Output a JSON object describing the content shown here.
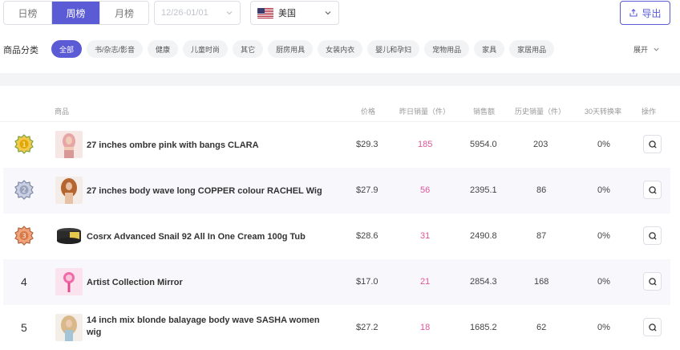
{
  "period_tabs": [
    {
      "label": "日榜",
      "active": false
    },
    {
      "label": "周榜",
      "active": true
    },
    {
      "label": "月榜",
      "active": false
    }
  ],
  "date_range": {
    "placeholder": "12/26-01/01"
  },
  "country": {
    "label": "美国",
    "icon": "us-flag-icon"
  },
  "export_label": "导出",
  "category": {
    "label": "商品分类",
    "chips": [
      "全部",
      "书/杂志/影音",
      "健康",
      "儿童时尚",
      "其它",
      "厨房用具",
      "女装内衣",
      "婴儿和孕妇",
      "宠物用品",
      "家具",
      "家居用品"
    ],
    "active_index": 0,
    "expand_label": "展开"
  },
  "table": {
    "headers": {
      "product": "商品",
      "price": "价格",
      "yesterday_sales": "昨日销量（件）",
      "sales_amount": "销售额",
      "history_sales": "历史销量（件）",
      "conversion": "30天转换率",
      "action": "操作"
    },
    "rows": [
      {
        "rank": "1",
        "medal": "gold-medal-icon",
        "name": "27 inches ombre pink with bangs CLARA",
        "price": "$29.3",
        "yesterday": "185",
        "amount": "5954.0",
        "history": "203",
        "conversion": "0%"
      },
      {
        "rank": "2",
        "medal": "silver-medal-icon",
        "name": "27 inches body wave long COPPER colour RACHEL Wig",
        "price": "$27.9",
        "yesterday": "56",
        "amount": "2395.1",
        "history": "86",
        "conversion": "0%"
      },
      {
        "rank": "3",
        "medal": "bronze-medal-icon",
        "name": "Cosrx Advanced Snail 92 All In One Cream 100g Tub",
        "price": "$28.6",
        "yesterday": "31",
        "amount": "2490.8",
        "history": "87",
        "conversion": "0%"
      },
      {
        "rank": "4",
        "medal": "",
        "name": "Artist Collection Mirror",
        "price": "$17.0",
        "yesterday": "21",
        "amount": "2854.3",
        "history": "168",
        "conversion": "0%"
      },
      {
        "rank": "5",
        "medal": "",
        "name": "14 inch mix blonde balayage body wave SASHA women wig",
        "price": "$27.2",
        "yesterday": "18",
        "amount": "1685.2",
        "history": "62",
        "conversion": "0%"
      }
    ]
  },
  "colors": {
    "accent": "#5b5bd6",
    "sales_highlight": "#e0569a"
  }
}
